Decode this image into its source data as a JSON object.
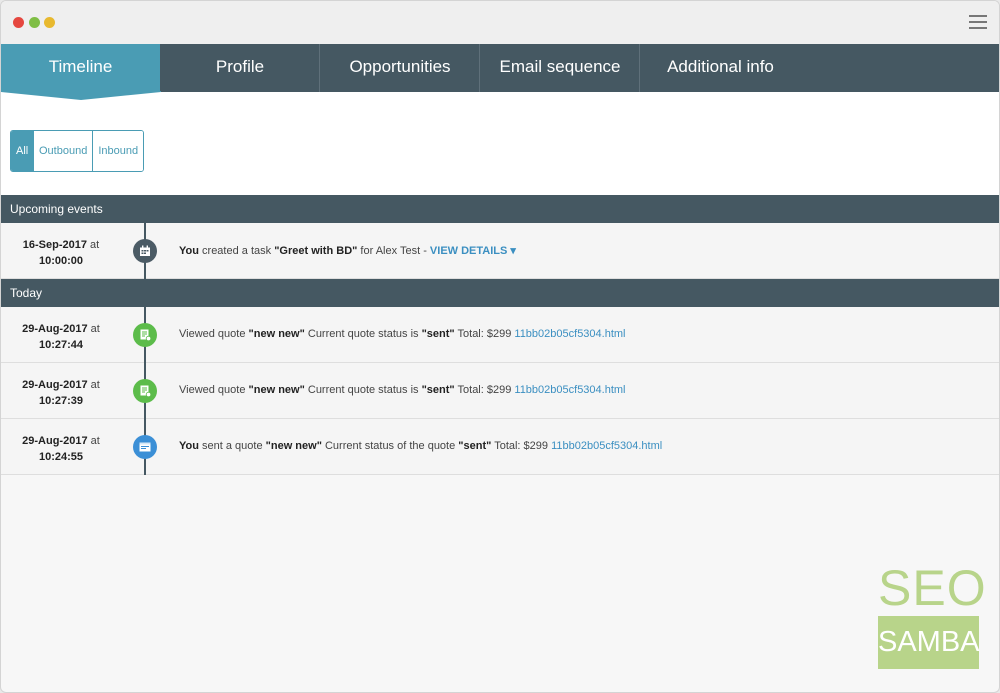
{
  "tabs": [
    {
      "label": "Timeline"
    },
    {
      "label": "Profile"
    },
    {
      "label": "Opportunities"
    },
    {
      "label": "Email sequence"
    },
    {
      "label": "Additional info"
    }
  ],
  "filters": {
    "all": "All",
    "outbound": "Outbound",
    "inbound": "Inbound"
  },
  "sections": {
    "upcoming": "Upcoming events",
    "today": "Today"
  },
  "events": [
    {
      "date": "16-Sep-2017",
      "at": "at",
      "time": "10:00:00",
      "icon": "calendar-icon",
      "actor": "You",
      "verb": " created a task ",
      "subject": "\"Greet with BD\"",
      "rest": " for Alex Test - ",
      "view": "VIEW DETAILS"
    },
    {
      "date": "29-Aug-2017",
      "at": "at",
      "time": "10:27:44",
      "icon": "quote-viewed-icon",
      "prefix": "Viewed quote ",
      "quote": "\"new new\"",
      "mid": " Current quote status is ",
      "status": "\"sent\"",
      "total": " Total: $299 ",
      "file": "11bb02b05cf5304.html"
    },
    {
      "date": "29-Aug-2017",
      "at": "at",
      "time": "10:27:39",
      "icon": "quote-viewed-icon",
      "prefix": "Viewed quote ",
      "quote": "\"new new\"",
      "mid": " Current quote status is ",
      "status": "\"sent\"",
      "total": " Total: $299 ",
      "file": "11bb02b05cf5304.html"
    },
    {
      "date": "29-Aug-2017",
      "at": "at",
      "time": "10:24:55",
      "icon": "quote-sent-icon",
      "actor": "You",
      "verb": " sent a quote ",
      "quote": "\"new new\"",
      "mid": " Current status of the quote ",
      "status": "\"sent\"",
      "total": " Total: $299 ",
      "file": "11bb02b05cf5304.html"
    }
  ],
  "logo": {
    "top": "SEO",
    "bottom": "SAMBA"
  },
  "colors": {
    "accent": "#4a9cb4",
    "header": "#455862",
    "green": "#5cbc4a",
    "blue": "#3b8fd6",
    "link": "#3b8fc1",
    "logo": "#b8d48a"
  }
}
